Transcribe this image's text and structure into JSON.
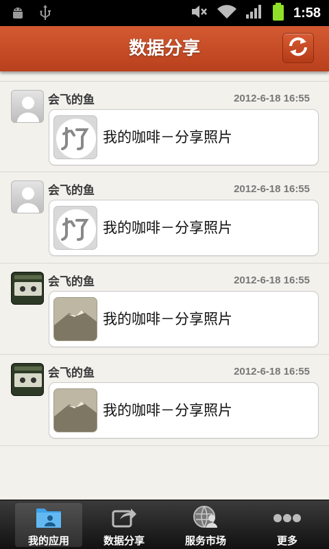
{
  "status_bar": {
    "time": "1:58",
    "icons": [
      "android-debug-icon",
      "usb-icon",
      "mute-icon",
      "wifi-icon",
      "signal-icon",
      "battery-icon"
    ]
  },
  "header": {
    "title": "数据分享",
    "refresh_icon": "refresh-icon"
  },
  "feed": [
    {
      "user": "会飞的鱼",
      "time": "2012-6-18 16:55",
      "text": "我的咖啡－分享照片",
      "avatar": "default-avatar",
      "thumb": "app-logo"
    },
    {
      "user": "会飞的鱼",
      "time": "2012-6-18 16:55",
      "text": "我的咖啡－分享照片",
      "avatar": "default-avatar",
      "thumb": "app-logo"
    },
    {
      "user": "会飞的鱼",
      "time": "2012-6-18 16:55",
      "text": "我的咖啡－分享照片",
      "avatar": "photo-avatar",
      "thumb": "mountain-photo"
    },
    {
      "user": "会飞的鱼",
      "time": "2012-6-18 16:55",
      "text": "我的咖啡－分享照片",
      "avatar": "photo-avatar",
      "thumb": "mountain-photo"
    }
  ],
  "tabs": [
    {
      "label": "我的应用",
      "icon": "folder-icon",
      "active": true
    },
    {
      "label": "数据分享",
      "icon": "share-icon",
      "active": false
    },
    {
      "label": "服务市场",
      "icon": "globe-user-icon",
      "active": false
    },
    {
      "label": "更多",
      "icon": "more-icon",
      "active": false
    }
  ],
  "colors": {
    "header": "#c54a25",
    "background": "#f2f1ec",
    "tabbar": "#1f1f1f"
  }
}
